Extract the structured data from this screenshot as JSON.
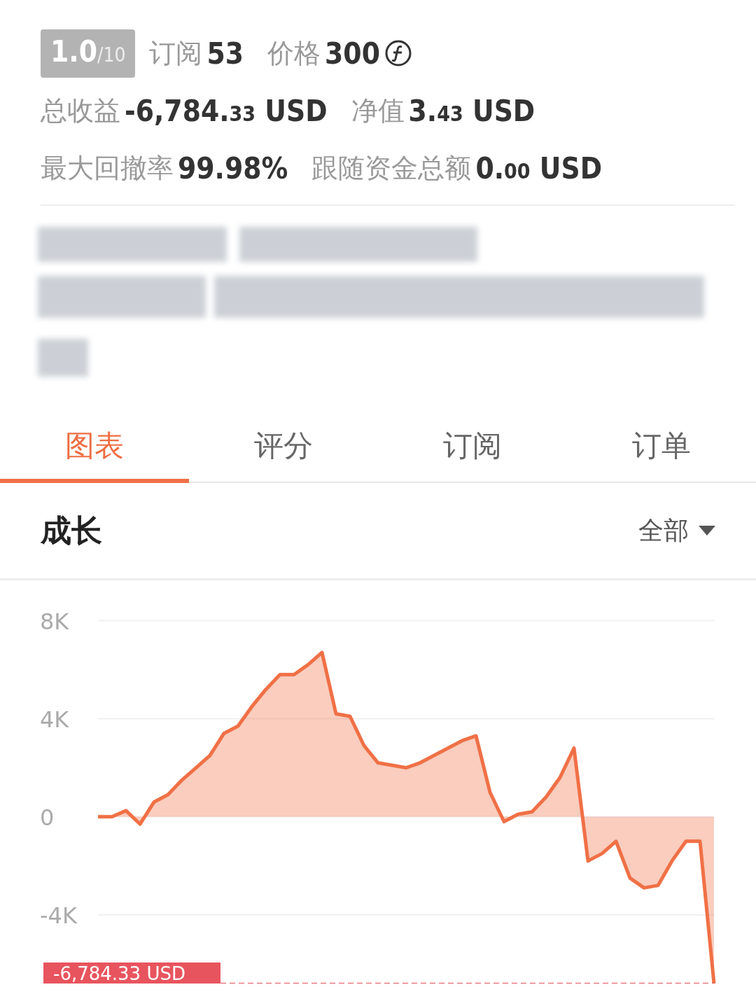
{
  "header": {
    "score": {
      "value": "1.0",
      "max": "/10"
    },
    "stats_row_1": [
      {
        "label": "订阅",
        "value": "53",
        "coin": false
      },
      {
        "label": "价格",
        "value": "300",
        "coin": true
      }
    ],
    "stats_row_2": [
      {
        "label": "总收益",
        "main": "-6,784.",
        "small": "33",
        "unit": "USD"
      },
      {
        "label": "净值",
        "main": "3.",
        "small": "43",
        "unit": "USD"
      }
    ],
    "stats_row_3": [
      {
        "label": "最大回撤率",
        "main": "99.98%"
      },
      {
        "label": "跟随资金总额",
        "main": "0.",
        "small": "00",
        "unit": "USD"
      }
    ]
  },
  "description": {
    "kind": "blurred"
  },
  "tabs": [
    {
      "label": "图表",
      "selected": true
    },
    {
      "label": "评分",
      "selected": false
    },
    {
      "label": "订阅",
      "selected": false
    },
    {
      "label": "订单",
      "selected": false
    }
  ],
  "section": {
    "title": "成长",
    "filter": "全部"
  },
  "growth_chart": {
    "chart_data": {
      "type": "area",
      "grid": true,
      "ylim": [
        -6800,
        8000
      ],
      "yticks": [
        {
          "value": 8000,
          "label": "8K"
        },
        {
          "value": 4000,
          "label": "4K"
        },
        {
          "value": 0,
          "label": "0"
        },
        {
          "value": -4000,
          "label": "-4K"
        }
      ],
      "series": [
        {
          "color": "#f07046",
          "values": [
            0,
            0,
            250,
            -300,
            600,
            900,
            1500,
            2000,
            2500,
            3400,
            3700,
            4500,
            5200,
            5800,
            5800,
            6200,
            6700,
            4200,
            4100,
            2900,
            2200,
            2100,
            2000,
            2200,
            2500,
            2800,
            3100,
            3300,
            1000,
            -200,
            100,
            200,
            800,
            1600,
            2800,
            -1800,
            -1500,
            -1000,
            -2500,
            -2900,
            -2800,
            -1800,
            -1000,
            -1000,
            -6800
          ]
        }
      ],
      "ref_lines": [
        {
          "label": "-6,784.33 USD",
          "color": "#e0505a"
        }
      ]
    }
  }
}
